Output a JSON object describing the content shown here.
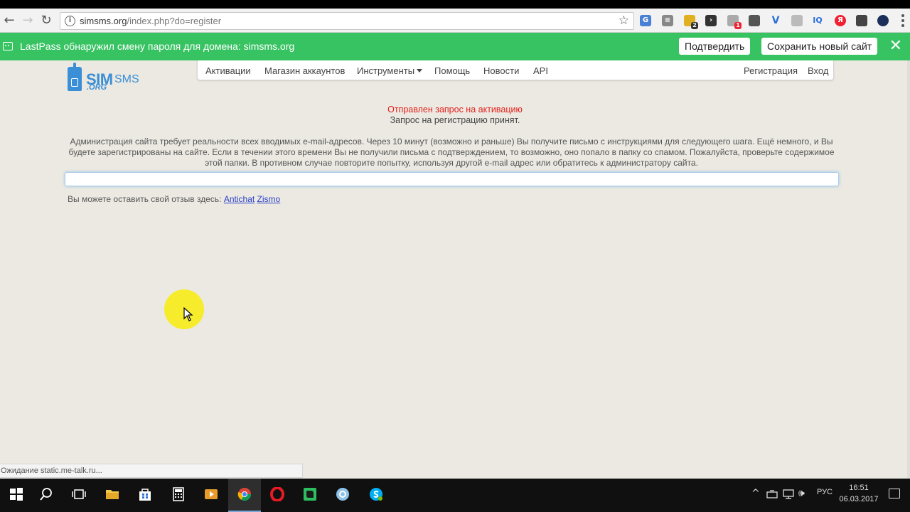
{
  "browser": {
    "url_host": "simsms.org",
    "url_path": "/index.php?do=register"
  },
  "lastpass": {
    "message": "LastPass обнаружил смену пароля для домена: simsms.org",
    "confirm_label": "Подтвердить",
    "save_label": "Сохранить новый сайт"
  },
  "logo": {
    "text_sim": "SIM",
    "text_sms": "SMS",
    "text_org": ".ORG"
  },
  "nav": {
    "items": [
      "Активации",
      "Магазин аккаунтов",
      "Инструменты",
      "Помощь",
      "Новости",
      "API"
    ],
    "register": "Регистрация",
    "login": "Вход"
  },
  "content": {
    "activation_sent": "Отправлен запрос на активацию",
    "registration_accepted": "Запрос на регистрацию принят.",
    "paragraph": "Администрация сайта требует реальности всех вводимых e-mail-адресов. Через 10 минут (возможно и раньше) Вы получите письмо с инструкциями для следующего шага. Ещё немного, и Вы будете зарегистрированы на сайте. Если в течении этого времени Вы не получили письма с подтверждением, то возможно, оно попало в папку со спамом. Пожалуйста, проверьте содержимое этой папки. В противном случае повторите попытку, используя другой e-mail адрес или обратитесь к администратору сайта.",
    "feedback_prefix": "Вы можете оставить свой отзыв здесь:",
    "feedback_link1": "Antichat",
    "feedback_link2": "Zismo"
  },
  "status_bar": "Ожидание static.me-talk.ru...",
  "extension_badges": {
    "badge_2": "2",
    "badge_1": "1",
    "iq": "IQ",
    "yandex": "Я"
  },
  "taskbar": {
    "lang": "РУС",
    "time": "16:51",
    "date": "06.03.2017"
  },
  "colors": {
    "lastpass_green": "#38c363",
    "alert_red": "#e3201b",
    "link_blue": "#2a3fc9",
    "brand_blue": "#3b8fd6"
  }
}
